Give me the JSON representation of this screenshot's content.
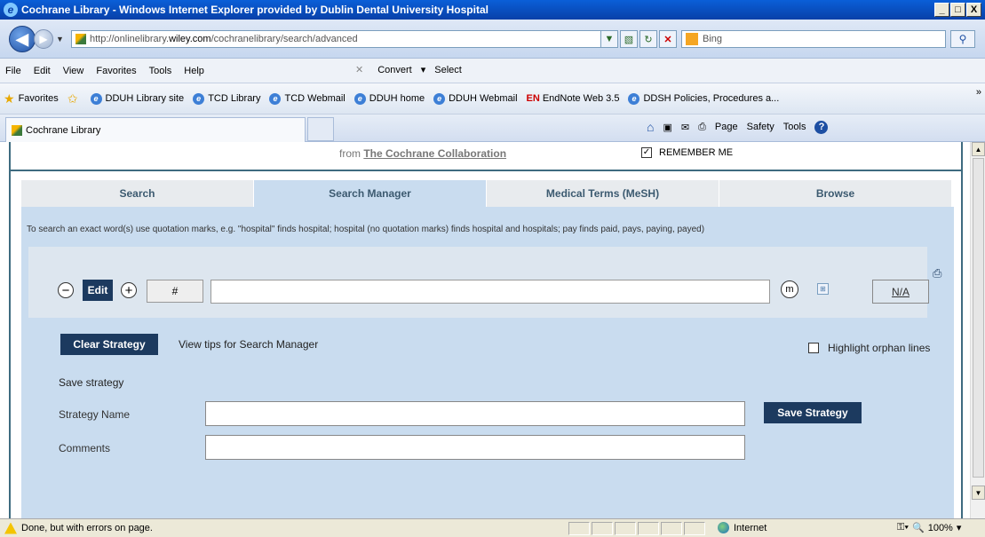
{
  "window": {
    "title": "Cochrane Library - Windows Internet Explorer provided by Dublin Dental University Hospital",
    "controls": [
      "_",
      "□",
      "X"
    ]
  },
  "address": {
    "url_prefix": "http://onlinelibrary.",
    "url_domain": "wiley.com",
    "url_path": "/cochranelibrary/search/advanced",
    "search_engine": "Bing"
  },
  "menu": {
    "items": [
      "File",
      "Edit",
      "View",
      "Favorites",
      "Tools",
      "Help"
    ],
    "convert": "Convert",
    "select": "Select"
  },
  "favorites": {
    "label": "Favorites",
    "items": [
      "DDUH Library site",
      "TCD Library",
      "TCD Webmail",
      "DDUH home",
      "DDUH Webmail",
      "EndNote Web 3.5",
      "DDSH Policies, Procedures a..."
    ]
  },
  "tab": {
    "title": "Cochrane Library",
    "commands": [
      "Page",
      "Safety",
      "Tools"
    ]
  },
  "page": {
    "from_text": "from ",
    "from_link": "The Cochrane Collaboration",
    "remember_me": "REMEMBER ME",
    "remember_checked": "✓",
    "tabs": [
      "Search",
      "Search Manager",
      "Medical Terms (MeSH)",
      "Browse"
    ],
    "active_tab": "Search Manager",
    "tip": "To search an exact word(s) use quotation marks, e.g. \"hospital\" finds hospital; hospital (no quotation marks) finds hospital and hospitals; pay finds paid, pays, paying, payed)",
    "line": {
      "minus": "−",
      "edit": "Edit",
      "plus": "+",
      "number": "#",
      "m": "m",
      "na": "N/A"
    },
    "clear_strategy": "Clear Strategy",
    "view_tips": "View tips for Search Manager",
    "highlight_orphan": "Highlight orphan lines",
    "save_heading": "Save strategy",
    "strategy_name_label": "Strategy Name",
    "comments_label": "Comments",
    "save_button": "Save Strategy"
  },
  "status": {
    "message": "Done, but with errors on page.",
    "zone": "Internet",
    "zoom": "100%"
  }
}
